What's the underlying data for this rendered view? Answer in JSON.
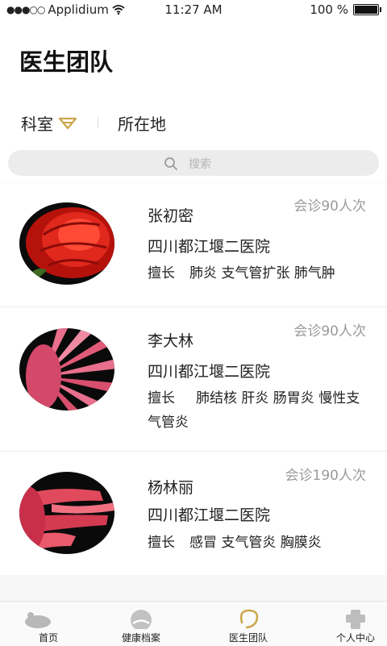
{
  "status_bar": {
    "carrier": "Applidium",
    "time": "11:27 AM",
    "battery": "100 %"
  },
  "header": {
    "title": "医生团队"
  },
  "filters": {
    "department": "科室",
    "location": "所在地"
  },
  "search": {
    "placeholder": "搜索"
  },
  "doctors": [
    {
      "name": "张初密",
      "consultations": "会诊90人次",
      "hospital": "四川都江堰二医院",
      "specialty_label": "擅长",
      "specialty": "肺炎 支气管扩张 肺气肿"
    },
    {
      "name": "李大林",
      "consultations": "会诊90人次",
      "hospital": "四川都江堰二医院",
      "specialty_label": "擅长",
      "specialty": "肺结核 肝炎 肠胃炎 慢性支气管炎"
    },
    {
      "name": "杨林丽",
      "consultations": "会诊190人次",
      "hospital": "四川都江堰二医院",
      "specialty_label": "擅长",
      "specialty": "感冒 支气管炎 胸膜炎"
    }
  ],
  "tabbar": {
    "tabs": [
      {
        "label": "首页"
      },
      {
        "label": "健康档案"
      },
      {
        "label": "医生团队"
      },
      {
        "label": "个人中心"
      }
    ]
  },
  "colors": {
    "accent": "#c9a64a",
    "muted_text": "#9a9a9a",
    "background": "#f7f7f7"
  }
}
